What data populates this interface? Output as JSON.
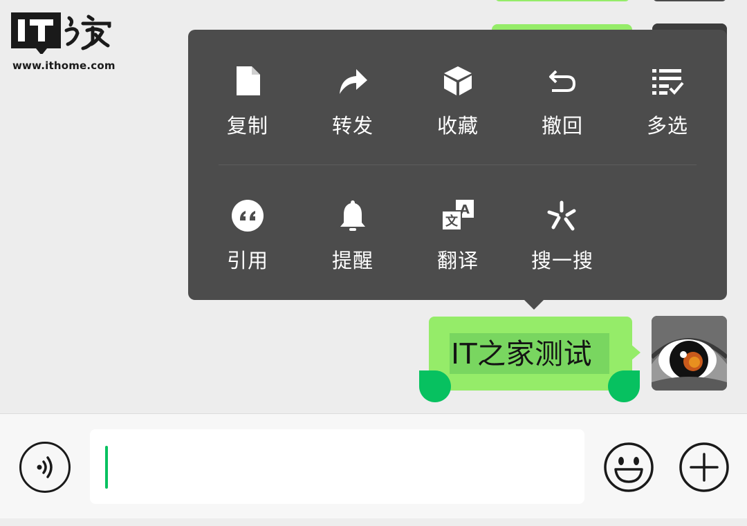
{
  "watermark": {
    "logo_text": "IT之家",
    "url": "www.ithome.com"
  },
  "context_menu": {
    "row1": [
      {
        "label": "复制",
        "icon": "copy-document-icon"
      },
      {
        "label": "转发",
        "icon": "forward-arrow-icon"
      },
      {
        "label": "收藏",
        "icon": "favorite-cube-icon"
      },
      {
        "label": "撤回",
        "icon": "recall-undo-icon"
      },
      {
        "label": "多选",
        "icon": "multi-select-list-icon"
      }
    ],
    "row2": [
      {
        "label": "引用",
        "icon": "quote-icon"
      },
      {
        "label": "提醒",
        "icon": "remind-bell-icon"
      },
      {
        "label": "翻译",
        "icon": "translate-icon"
      },
      {
        "label": "搜一搜",
        "icon": "search-spark-icon"
      }
    ]
  },
  "message": {
    "text": "IT之家测试",
    "selected": true
  },
  "input_bar": {
    "voice_icon": "voice-icon",
    "emoji_icon": "emoji-icon",
    "plus_icon": "plus-icon",
    "value": ""
  },
  "colors": {
    "bubble": "#95ec69",
    "accent": "#07c160",
    "menu_bg": "#4c4c4c",
    "background": "#ededed"
  }
}
